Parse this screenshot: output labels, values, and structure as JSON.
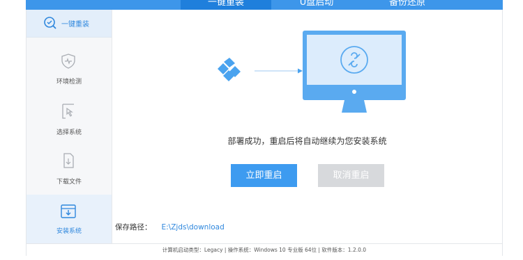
{
  "tabs": [
    {
      "label": "一键重装",
      "active": true
    },
    {
      "label": "U盘启动",
      "active": false
    },
    {
      "label": "备份还原",
      "active": false
    }
  ],
  "sidebar": {
    "top": {
      "label": "一键重装",
      "icon": "search-shield-icon"
    },
    "items": [
      {
        "label": "环境检测",
        "icon": "shield-pulse-icon"
      },
      {
        "label": "选择系统",
        "icon": "cursor-icon"
      },
      {
        "label": "下载文件",
        "icon": "document-download-icon"
      },
      {
        "label": "安装系统",
        "icon": "install-box-icon",
        "active": true
      }
    ]
  },
  "main": {
    "message": "部署成功，重启后将自动继续为您安装系统",
    "restart_button": "立即重启",
    "cancel_button": "取消重启",
    "path_label": "保存路径：",
    "path_value": "E:\\Zjds\\download"
  },
  "status": {
    "text": "计算机启动类型：Legacy | 操作系统：Windows 10 专业版 64位 | 软件版本：1.2.0.0"
  },
  "colors": {
    "accent": "#3d96ea",
    "accent_dark": "#1f7fdc",
    "button_primary": "#3d9bf0",
    "button_disabled": "#d7d9dc",
    "sidebar_bg": "#f6f7f9",
    "link": "#2e87dd"
  }
}
